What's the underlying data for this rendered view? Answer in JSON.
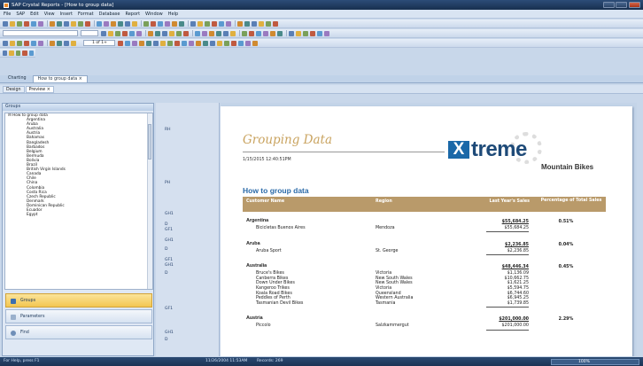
{
  "window": {
    "title": "SAP Crystal Reports - [How to group data]"
  },
  "menu": [
    "File",
    "SAP",
    "Edit",
    "View",
    "Insert",
    "Format",
    "Database",
    "Report",
    "Window",
    "Help"
  ],
  "toolbar3": {
    "page_indicator": "1 of 1+"
  },
  "doc_tabs": [
    "Charting",
    "How to group data"
  ],
  "sub_tabs": [
    "Design",
    "Preview"
  ],
  "left_panel": {
    "header": "Groups",
    "root": "How to group data",
    "countries": [
      "Argentina",
      "Aruba",
      "Australia",
      "Austria",
      "Bahamas",
      "Bangladesh",
      "Barbados",
      "Belgium",
      "Bermuda",
      "Bolivia",
      "Brazil",
      "British Virgin Islands",
      "Canada",
      "Chile",
      "China",
      "Colombia",
      "Costa Rica",
      "Czech Republic",
      "Denmark",
      "Dominican Republic",
      "Ecuador",
      "Egypt"
    ],
    "nav": [
      {
        "label": "Groups",
        "icon": "groups-icon"
      },
      {
        "label": "Parameters",
        "icon": "parameters-icon"
      },
      {
        "label": "Find",
        "icon": "find-icon"
      }
    ]
  },
  "sections": [
    {
      "label": "RH"
    },
    {
      "label": "PH"
    },
    {
      "label": "GH1"
    },
    {
      "label": "D"
    },
    {
      "label": "GF1"
    },
    {
      "label": "GH1"
    },
    {
      "label": "D"
    },
    {
      "label": "GF1"
    },
    {
      "label": "GH1"
    },
    {
      "label": "D"
    },
    {
      "label": "GF1"
    },
    {
      "label": "GH1"
    },
    {
      "label": "D"
    }
  ],
  "report": {
    "title": "Grouping Data",
    "date_time": "1/15/2015   12:40:51PM",
    "logo": {
      "x": "X",
      "name": "treme",
      "tagline": "Mountain Bikes"
    },
    "subtitle": "How to group data",
    "columns": {
      "customer": "Customer Name",
      "region": "Region",
      "sales": "Last Year's Sales",
      "percentage": "Percentage of Total Sales"
    },
    "groups": [
      {
        "name": "Argentina",
        "total": "$55,684.25",
        "percent": "0.51%",
        "rows": [
          {
            "customer": "Bicicletas Buenos Aires",
            "region": "Mendoza",
            "sales": "$55,684.25"
          }
        ]
      },
      {
        "name": "Aruba",
        "total": "$2,236.85",
        "percent": "0.04%",
        "rows": [
          {
            "customer": "Aruba Sport",
            "region": "St. George",
            "sales": "$2,236.85"
          }
        ]
      },
      {
        "name": "Australia",
        "total": "$48,446.34",
        "percent": "0.45%",
        "rows": [
          {
            "customer": "Bruce's Bikes",
            "region": "Victoria",
            "sales": "$1,136.09"
          },
          {
            "customer": "Canberra Bikes",
            "region": "New South Wales",
            "sales": "$10,662.75"
          },
          {
            "customer": "Down Under Bikes",
            "region": "New South Wales",
            "sales": "$1,621.25"
          },
          {
            "customer": "Kangeroo Trikes",
            "region": "Victoria",
            "sales": "$5,594.75"
          },
          {
            "customer": "Koala Road Bikes",
            "region": "Queensland",
            "sales": "$6,744.60"
          },
          {
            "customer": "Peddles of Perth",
            "region": "Western Australia",
            "sales": "$6,945.25"
          },
          {
            "customer": "Tasmanian Devil Bikes",
            "region": "Tasmania",
            "sales": "$1,739.85"
          }
        ]
      },
      {
        "name": "Austria",
        "total": "$201,000.00",
        "percent": "2.29%",
        "rows": [
          {
            "customer": "Piccolo",
            "region": "Salzkammergut",
            "sales": "$201,000.00"
          }
        ]
      }
    ]
  },
  "status": {
    "help": "For Help, press F1",
    "datetime": "11/26/2004  11:53AM",
    "records": "Records: 269",
    "zoom": "100%"
  },
  "colors": {
    "accent": "#b99a6a",
    "subtitle": "#2b6aa8",
    "title": "#c9a35f",
    "status_bg": "#1c3354"
  }
}
